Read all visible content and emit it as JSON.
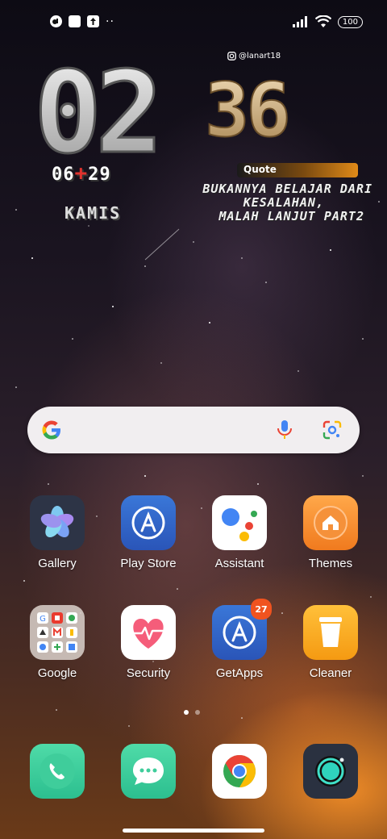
{
  "status_bar": {
    "battery": "100",
    "left_icons": [
      "app-notification-icon",
      "square-notification-icon",
      "upload-notification-icon"
    ],
    "more": "··"
  },
  "clock_widget": {
    "hour": "02",
    "minute": "36",
    "handle": "@lanart18",
    "date_left": "06",
    "date_sep": "+",
    "date_right": "29",
    "day": "KAMIS",
    "quote_label": "Quote",
    "quote_lines": [
      "BUKANNYA BELAJAR DARI",
      "KESALAHAN,",
      "MALAH LANJUT PART2"
    ],
    "colors": {
      "hour": "#d9d9d9",
      "minute": "#d8b88a",
      "accent": "#e08a18",
      "date_sep": "#e0322e"
    }
  },
  "search_bar": {
    "icons": [
      "google-g-icon",
      "microphone-icon",
      "google-lens-icon"
    ]
  },
  "apps_row1": [
    {
      "label": "Gallery",
      "icon": "gallery-flower-icon"
    },
    {
      "label": "Play Store",
      "icon": "play-store-icon"
    },
    {
      "label": "Assistant",
      "icon": "assistant-icon"
    },
    {
      "label": "Themes",
      "icon": "themes-house-icon"
    }
  ],
  "apps_row2": [
    {
      "label": "Google",
      "icon": "google-folder-icon"
    },
    {
      "label": "Security",
      "icon": "security-heart-icon"
    },
    {
      "label": "GetApps",
      "icon": "getapps-icon",
      "badge": "27"
    },
    {
      "label": "Cleaner",
      "icon": "cleaner-trash-icon"
    }
  ],
  "page_indicator": {
    "pages": 2,
    "current": 1
  },
  "dock": [
    {
      "name": "phone",
      "icon": "phone-icon"
    },
    {
      "name": "messages",
      "icon": "message-icon"
    },
    {
      "name": "chrome",
      "icon": "chrome-icon"
    },
    {
      "name": "camera",
      "icon": "camera-icon"
    }
  ]
}
